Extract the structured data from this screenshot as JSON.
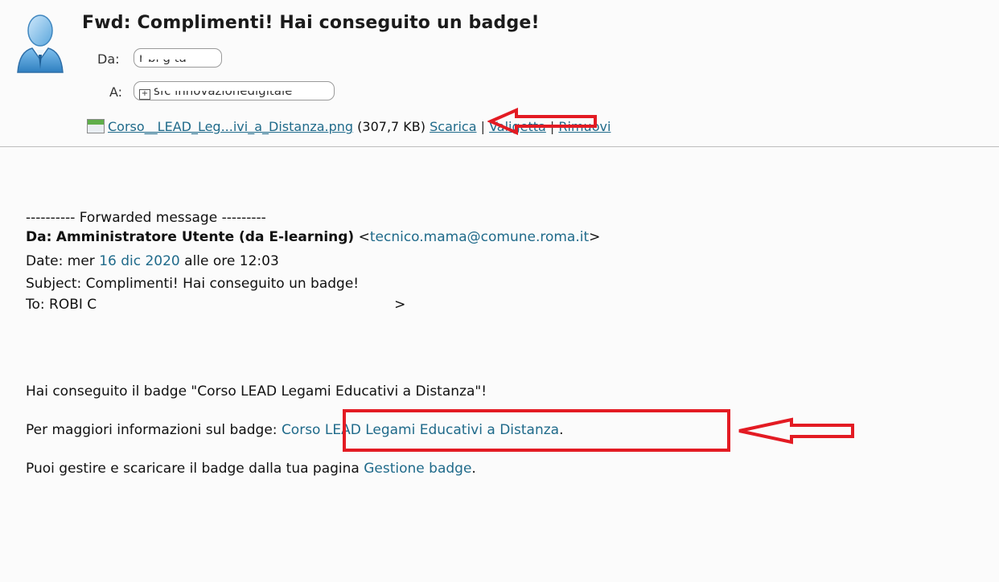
{
  "header": {
    "subject": "Fwd: Complimenti! Hai conseguito un badge!",
    "from_label": "Da:",
    "from_value": "r bi  g  ta",
    "to_label": "A:",
    "to_value": "sfc innovazionedigitale",
    "attachment": {
      "filename": "Corso__LEAD_Leg...ivi_a_Distanza.png",
      "size": "(307,7 KB)",
      "download": "Scarica",
      "briefcase": "Valigetta",
      "remove": "Rimuovi"
    }
  },
  "message": {
    "forward_header": "---------- Forwarded message ---------",
    "from_label": "Da:",
    "from_name": "Amministratore Utente (da E-learning)",
    "from_email_open": "<",
    "from_email": "tecnico.mama@comune.roma.it",
    "from_email_close": ">",
    "date_label": "Date: mer ",
    "date_value": "16 dic 2020",
    "date_time": " alle ore 12:03",
    "subject_line": "Subject: Complimenti! Hai conseguito un badge!",
    "to_line": "To: ROBI C",
    "to_tail": ">",
    "paragraph1": "Hai conseguito il badge \"Corso LEAD Legami Educativi a Distanza\"!",
    "paragraph2_prefix": "Per maggiori informazioni sul badge: ",
    "paragraph2_link": "Corso LEAD Legami Educativi a Distanza",
    "paragraph2_suffix": ".",
    "paragraph3_prefix": "Puoi gestire e scaricare il badge dalla tua pagina ",
    "paragraph3_link": "Gestione badge",
    "paragraph3_suffix": "."
  },
  "annotations": {
    "accent_color": "#e31b23",
    "link_color": "#1f6a8a"
  }
}
